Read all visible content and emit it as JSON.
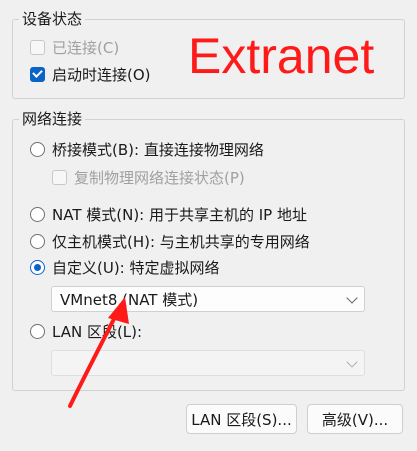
{
  "device_status": {
    "title": "设备状态",
    "connected_label": "已连接(C)",
    "connect_at_power_on_label": "启动时连接(O)"
  },
  "network_connection": {
    "title": "网络连接",
    "bridged_label": "桥接模式(B): 直接连接物理网络",
    "replicate_state_label": "复制物理网络连接状态(P)",
    "nat_label": "NAT 模式(N): 用于共享主机的 IP 地址",
    "host_only_label": "仅主机模式(H): 与主机共享的专用网络",
    "custom_label": "自定义(U): 特定虚拟网络",
    "custom_selected_value": "VMnet8 (NAT 模式)",
    "lan_segment_label": "LAN 区段(L):",
    "lan_segment_value": ""
  },
  "buttons": {
    "lan_segments": "LAN 区段(S)...",
    "advanced": "高级(V)..."
  },
  "annotation": {
    "text": "Extranet",
    "color": "#ff1a1a"
  },
  "accent_color": "#0a64c8"
}
